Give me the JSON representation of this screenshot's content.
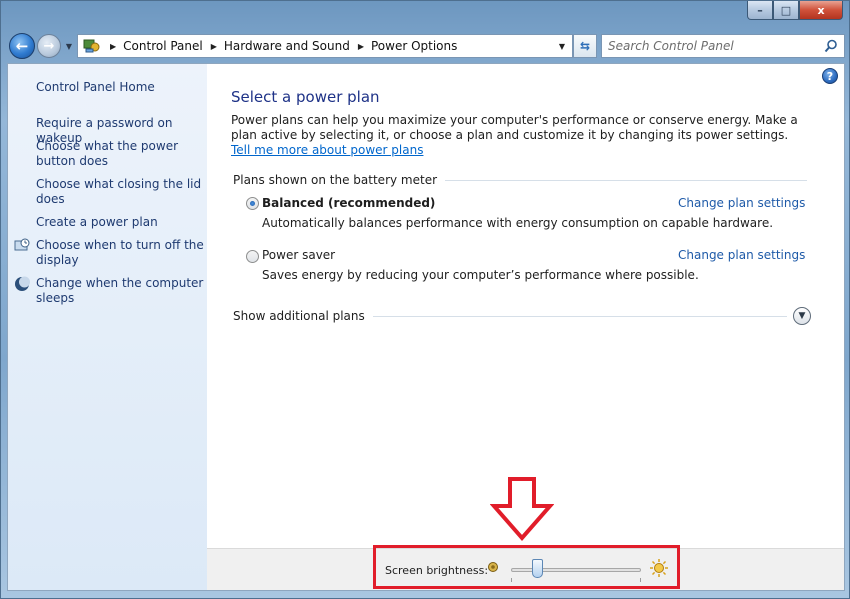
{
  "window": {
    "caption": {
      "minimize": "–",
      "maximize": "□",
      "close": "x"
    }
  },
  "address_bar": {
    "breadcrumbs": [
      "Control Panel",
      "Hardware and Sound",
      "Power Options"
    ],
    "search_placeholder": "Search Control Panel"
  },
  "sidebar": {
    "home": "Control Panel Home",
    "links": [
      "Require a password on wakeup",
      "Choose what the power button does",
      "Choose what closing the lid does",
      "Create a power plan",
      "Choose when to turn off the display",
      "Change when the computer sleeps"
    ]
  },
  "main": {
    "title": "Select a power plan",
    "intro": "Power plans can help you maximize your computer's performance or conserve energy. Make a plan active by selecting it, or choose a plan and customize it by changing its power settings.",
    "intro_link": "Tell me more about power plans",
    "group_header": "Plans shown on the battery meter",
    "plans": [
      {
        "name": "Balanced (recommended)",
        "description": "Automatically balances performance with energy consumption on capable hardware.",
        "link": "Change plan settings",
        "selected": true
      },
      {
        "name": "Power saver",
        "description": "Saves energy by reducing your computer’s performance where possible.",
        "link": "Change plan settings",
        "selected": false
      }
    ],
    "additional_plans": "Show additional plans"
  },
  "bottom": {
    "brightness_label": "Screen brightness:",
    "brightness_level": 0.18
  },
  "colors": {
    "link": "#1e5aa8",
    "title": "#1e3287",
    "annotation": "#e11d2a"
  }
}
